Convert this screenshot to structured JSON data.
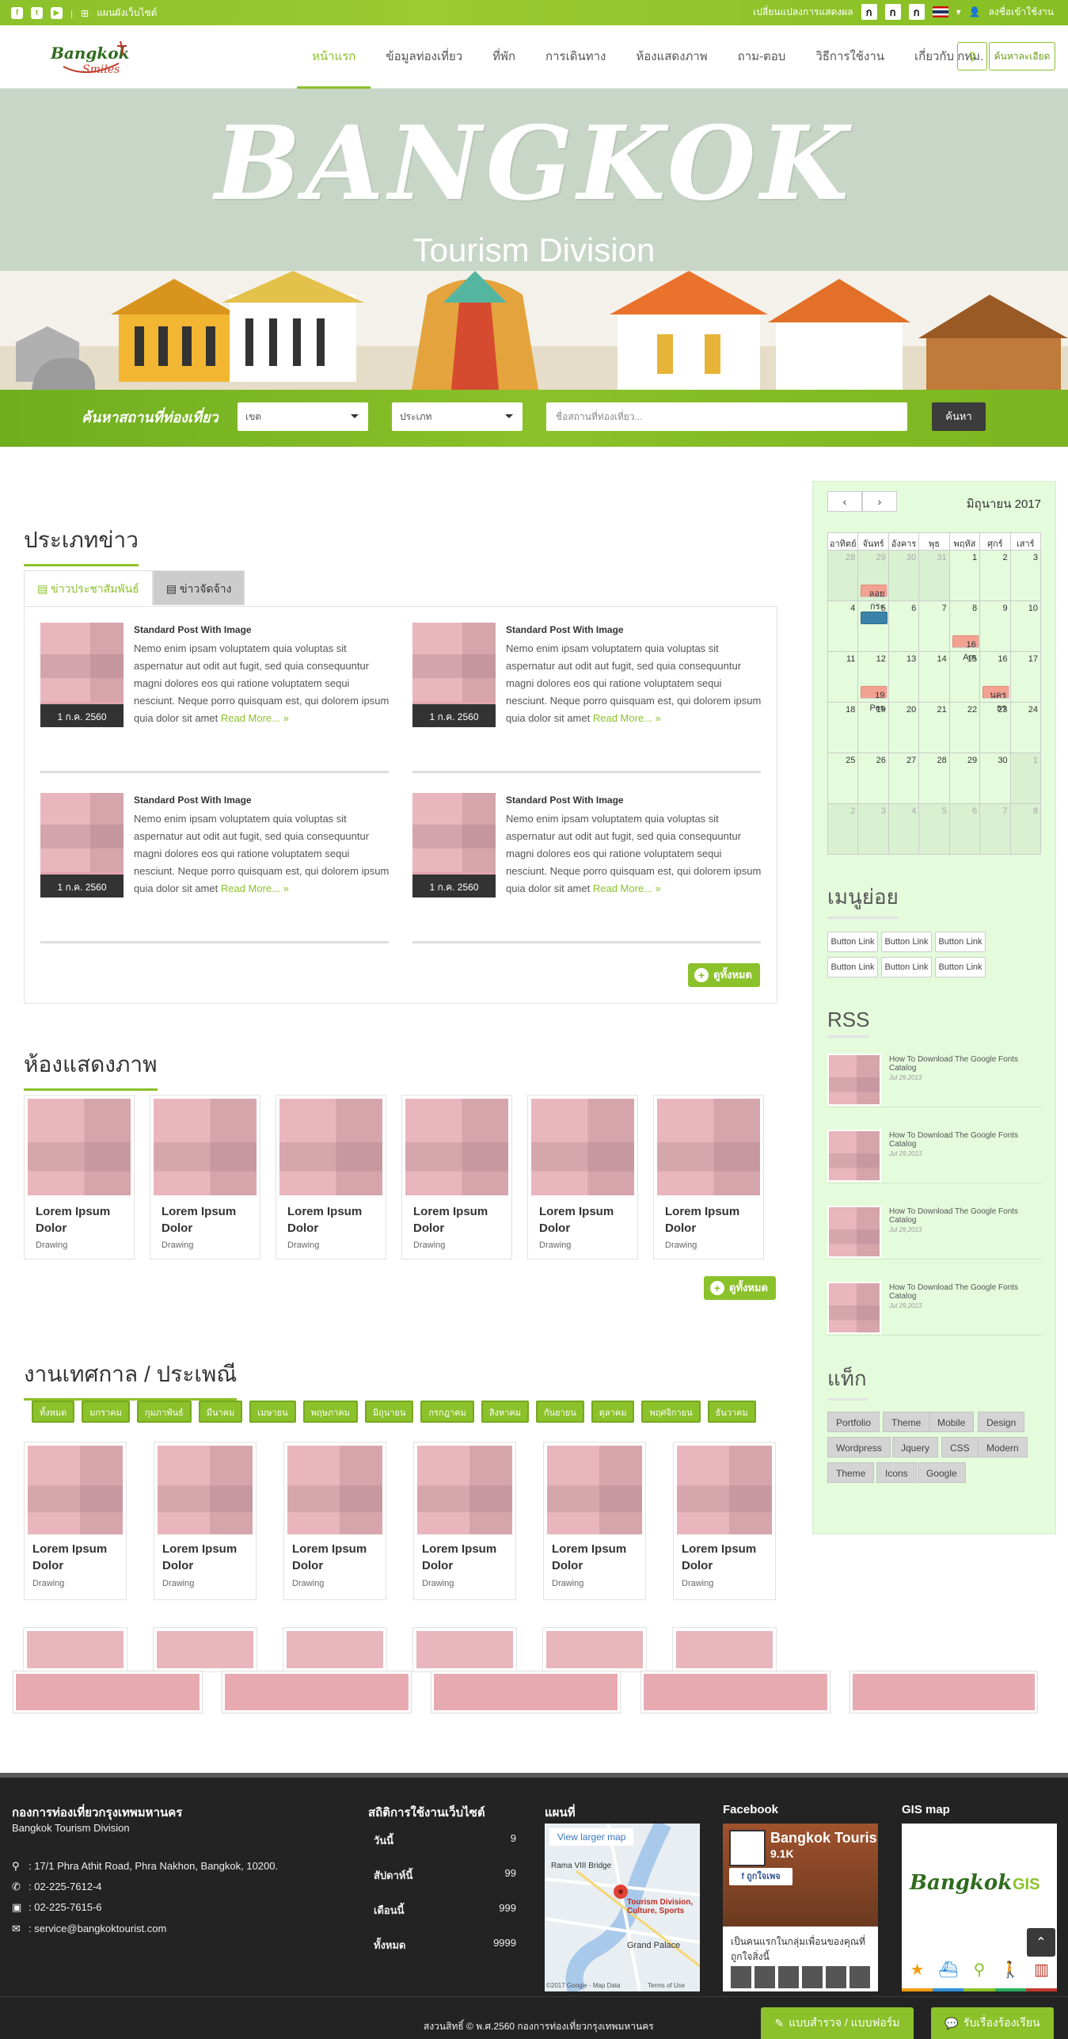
{
  "topbar": {
    "site_map": "แผนผังเว็บไซต์",
    "font_size_label": "เปลี่ยนแปลงการแสดงผล",
    "font_sizes": [
      "ก",
      "ก",
      "ก"
    ],
    "login": "ลงชื่อเข้าใช้งาน"
  },
  "header": {
    "logo_text": "Bangkok",
    "logo_sub": "Smiles",
    "nav": [
      "หน้าแรก",
      "ข้อมูลท่องเที่ยว",
      "ที่พัก",
      "การเดินทาง",
      "ห้องแสดงภาพ",
      "ถาม-ตอบ",
      "วิธีการใช้งาน",
      "เกี่ยวกับ กทม."
    ],
    "advanced_search": "ค้นหาละเอียด"
  },
  "hero": {
    "title": "BANGKOK",
    "subtitle": "Tourism Division"
  },
  "search": {
    "label": "ค้นหาสถานที่ท่องเที่ยว",
    "district": "เขต",
    "type": "ประเภท",
    "placeholder": "ชื่อสถานที่ท่องเที่ยว...",
    "button": "ค้นหา"
  },
  "news": {
    "title": "ประเภทข่าว",
    "tabs": [
      "ข่าวประชาสัมพันธ์",
      "ข่าวจัดจ้าง"
    ],
    "posts": [
      {
        "date": "1 ก.ค. 2560",
        "title": "Standard Post With Image",
        "body": "Nemo enim ipsam voluptatem quia voluptas sit aspernatur aut odit aut fugit, sed quia consequuntur magni dolores eos qui ratione voluptatem sequi nesciunt. Neque porro quisquam est, qui dolorem ipsum quia dolor sit amet",
        "more": "Read More..."
      },
      {
        "date": "1 ก.ค. 2560",
        "title": "Standard Post With Image",
        "body": "Nemo enim ipsam voluptatem quia voluptas sit aspernatur aut odit aut fugit, sed quia consequuntur magni dolores eos qui ratione voluptatem sequi nesciunt. Neque porro quisquam est, qui dolorem ipsum quia dolor sit amet",
        "more": "Read More..."
      },
      {
        "date": "1 ก.ค. 2560",
        "title": "Standard Post With Image",
        "body": "Nemo enim ipsam voluptatem quia voluptas sit aspernatur aut odit aut fugit, sed quia consequuntur magni dolores eos qui ratione voluptatem sequi nesciunt. Neque porro quisquam est, qui dolorem ipsum quia dolor sit amet",
        "more": "Read More..."
      },
      {
        "date": "1 ก.ค. 2560",
        "title": "Standard Post With Image",
        "body": "Nemo enim ipsam voluptatem quia voluptas sit aspernatur aut odit aut fugit, sed quia consequuntur magni dolores eos qui ratione voluptatem sequi nesciunt. Neque porro quisquam est, qui dolorem ipsum quia dolor sit amet",
        "more": "Read More..."
      }
    ],
    "view_all": "ดูทั้งหมด"
  },
  "gallery": {
    "title": "ห้องแสดงภาพ",
    "items": [
      {
        "title": "Lorem Ipsum Dolor",
        "sub": "Drawing"
      },
      {
        "title": "Lorem Ipsum Dolor",
        "sub": "Drawing"
      },
      {
        "title": "Lorem Ipsum Dolor",
        "sub": "Drawing"
      },
      {
        "title": "Lorem Ipsum Dolor",
        "sub": "Drawing"
      },
      {
        "title": "Lorem Ipsum Dolor",
        "sub": "Drawing"
      },
      {
        "title": "Lorem Ipsum Dolor",
        "sub": "Drawing"
      }
    ],
    "view_all": "ดูทั้งหมด"
  },
  "festival": {
    "title": "งานเทศกาล / ประเพณี",
    "months": [
      "ทั้งหมด",
      "มกราคม",
      "กุมภาพันธ์",
      "มีนาคม",
      "เมษายน",
      "พฤษภาคม",
      "มิถุนายน",
      "กรกฎาคม",
      "สิงหาคม",
      "กันยายน",
      "ตุลาคม",
      "พฤศจิกายน",
      "ธันวาคม"
    ],
    "items": [
      {
        "title": "Lorem Ipsum Dolor",
        "sub": "Drawing"
      },
      {
        "title": "Lorem Ipsum Dolor",
        "sub": "Drawing"
      },
      {
        "title": "Lorem Ipsum Dolor",
        "sub": "Drawing"
      },
      {
        "title": "Lorem Ipsum Dolor",
        "sub": "Drawing"
      },
      {
        "title": "Lorem Ipsum Dolor",
        "sub": "Drawing"
      },
      {
        "title": "Lorem Ipsum Dolor",
        "sub": "Drawing"
      }
    ]
  },
  "calendar": {
    "month": "มิถุนายน 2017",
    "days": [
      "อาทิตย์",
      "จันทร์",
      "อังคาร",
      "พุธ",
      "พฤหัส",
      "ศุกร์",
      "เสาร์"
    ],
    "cells": [
      "28",
      "29",
      "30",
      "31",
      "1",
      "2",
      "3",
      "4",
      "5",
      "6",
      "7",
      "8",
      "9",
      "10",
      "11",
      "12",
      "13",
      "14",
      "15",
      "16",
      "17",
      "18",
      "19",
      "20",
      "21",
      "22",
      "23",
      "24",
      "25",
      "26",
      "27",
      "28",
      "29",
      "30",
      "1",
      "2",
      "3",
      "4",
      "5",
      "6",
      "7",
      "8"
    ],
    "events": [
      {
        "label": "ลอยกระ",
        "cell": 1,
        "row": 0
      },
      {
        "label": "16 Am",
        "cell": 11,
        "row": 0
      },
      {
        "label": "19 Pes",
        "cell": 15,
        "row": 0
      },
      {
        "label": "นครธร",
        "cell": 19,
        "row": 0
      }
    ]
  },
  "submenu": {
    "title": "เมนูย่อย",
    "buttons": [
      "Button Link",
      "Button Link",
      "Button Link",
      "Button Link",
      "Button Link",
      "Button Link"
    ]
  },
  "rss": {
    "title": "RSS",
    "items": [
      {
        "title": "How To Download The Google Fonts Catalog",
        "date": "Jul 29,2013"
      },
      {
        "title": "How To Download The Google Fonts Catalog",
        "date": "Jul 29,2013"
      },
      {
        "title": "How To Download The Google Fonts Catalog",
        "date": "Jul 29,2013"
      },
      {
        "title": "How To Download The Google Fonts Catalog",
        "date": "Jul 29,2013"
      }
    ]
  },
  "tags": {
    "title": "แท็ก",
    "items": [
      "Portfolio",
      "Theme",
      "Mobile",
      "Design",
      "Wordpress",
      "Jquery",
      "CSS",
      "Modern",
      "Theme",
      "Icons",
      "Google"
    ]
  },
  "footer": {
    "org": "กองการท่องเที่ยวกรุงเทพมหานคร",
    "org_en": "Bangkok Tourism Division",
    "address": ": 17/1 Phra Athit Road, Phra Nakhon, Bangkok, 10200.",
    "phone": ": 02-225-7612-4",
    "fax": ": 02-225-7615-6",
    "email": ": service@bangkoktourist.com",
    "stats_title": "สถิติการใช้งานเว็บไซต์",
    "stats": [
      {
        "label": "วันนี้",
        "value": "9"
      },
      {
        "label": "สัปดาห์นี้",
        "value": "99"
      },
      {
        "label": "เดือนนี้",
        "value": "999"
      },
      {
        "label": "ทั้งหมด",
        "value": "9999"
      }
    ],
    "map_title": "แผนที่",
    "map_link": "View larger map",
    "map_place": "Tourism Division, Culture, Sports",
    "map_labels": [
      "Rama VIII Bridge",
      "Grand Palace",
      "©2017 Google - Map Data",
      "Terms of Use"
    ],
    "fb_title": "Facebook",
    "fb_page": "Bangkok Touris",
    "fb_likes": "9.1K",
    "fb_like_btn": "ถูกใจเพจ",
    "fb_text": "เป็นคนแรกในกลุ่มเพื่อนของคุณที่ถูกใจสิ่งนี้",
    "gis_title": "GIS map",
    "gis_logo": "Bangkok",
    "gis_label": "GIS",
    "copyright": "สงวนสิทธิ์ © พ.ศ.2560 กองการท่องเที่ยวกรุงเทพมหานคร",
    "survey_btn": "แบบสำรวจ / แบบฟอร์ม",
    "complaint_btn": "รับเรื่องร้องเรียน"
  },
  "colors": {
    "accent": "#8bc12a",
    "dark": "#232323",
    "sidebar": "#e4fbdc"
  }
}
